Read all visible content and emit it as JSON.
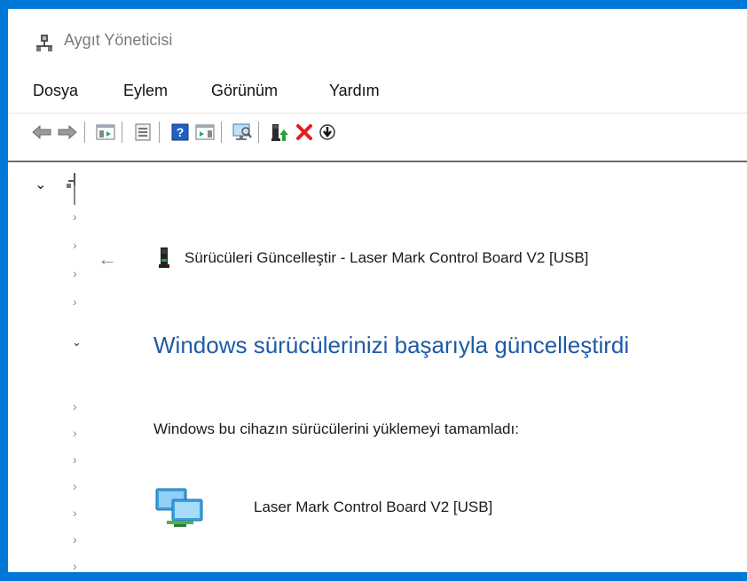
{
  "window": {
    "title": "Aygıt Yöneticisi"
  },
  "menu": [
    "Dosya",
    "Eylem",
    "Görünüm",
    "Yardım"
  ],
  "toolbar": {
    "icons": [
      "back-icon",
      "forward-icon",
      "show-hide-console-tree-icon",
      "properties-icon",
      "help-icon",
      "action-pane-icon",
      "scan-hardware-icon",
      "update-driver-icon",
      "uninstall-device-icon",
      "disable-device-icon"
    ],
    "colors": {
      "help": "#2060c0",
      "uninstall": "#e02020",
      "update": "#2aa040"
    }
  },
  "tree": {
    "expanded_marker": "⌄",
    "collapsed_marker": "›"
  },
  "dialog": {
    "back_glyph": "←",
    "title": "Sürücüleri Güncelleştir - Laser Mark Control Board V2 [USB]",
    "heading": "Windows sürücülerinizi başarıyla güncelleştirdi",
    "message": "Windows bu cihazın sürücülerini yüklemeyi tamamladı:",
    "device_name": "Laser Mark Control Board V2 [USB]",
    "device_icon": "network-adapter-icon",
    "heading_color": "#1e5aa8"
  },
  "desktop_color": "#0078d7"
}
